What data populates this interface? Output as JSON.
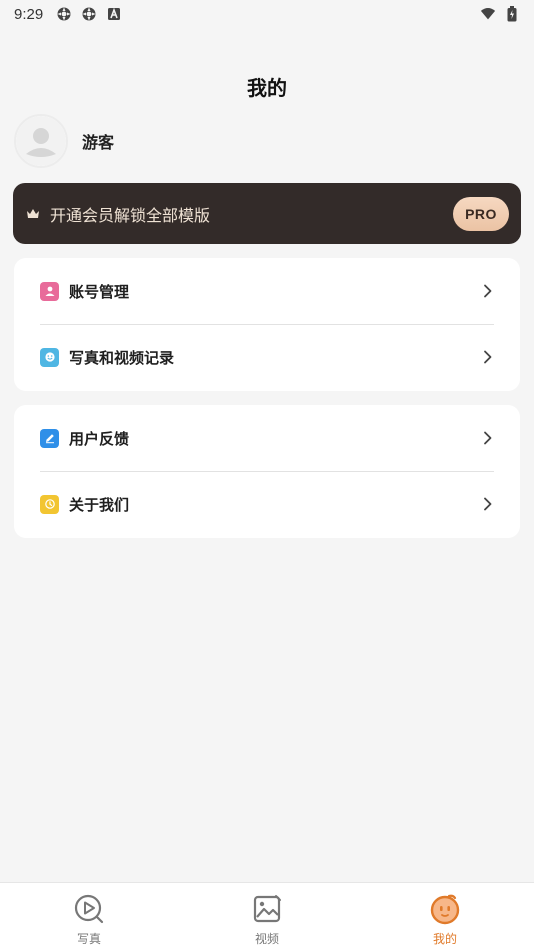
{
  "status_bar": {
    "time": "9:29",
    "icons_left": [
      "settings-icon",
      "settings-icon",
      "notification-a-icon"
    ],
    "icons_right": [
      "wifi-icon",
      "battery-icon"
    ]
  },
  "header": {
    "title": "我的"
  },
  "profile": {
    "avatar_icon": "default-avatar-icon",
    "username": "游客"
  },
  "pro_banner": {
    "icon": "crown-icon",
    "text": "开通会员解锁全部模版",
    "badge": "PRO",
    "colors": {
      "background": "#332b29",
      "text": "#efe2d4",
      "badge": "#ebc3a4"
    }
  },
  "menu_groups": [
    {
      "items": [
        {
          "label": "账号管理",
          "icon": "user-icon",
          "icon_color": "#e86b9a"
        },
        {
          "label": "写真和视频记录",
          "icon": "smile-icon",
          "icon_color": "#4fb6e3"
        }
      ]
    },
    {
      "items": [
        {
          "label": "用户反馈",
          "icon": "edit-icon",
          "icon_color": "#2f8fe8"
        },
        {
          "label": "关于我们",
          "icon": "info-icon",
          "icon_color": "#f2c531"
        }
      ]
    }
  ],
  "bottom_nav": {
    "items": [
      {
        "label": "写真",
        "icon": "play-search-icon",
        "active": false
      },
      {
        "label": "视频",
        "icon": "image-icon",
        "active": false
      },
      {
        "label": "我的",
        "icon": "face-icon",
        "active": true
      }
    ],
    "active_color": "#e07a2a"
  }
}
